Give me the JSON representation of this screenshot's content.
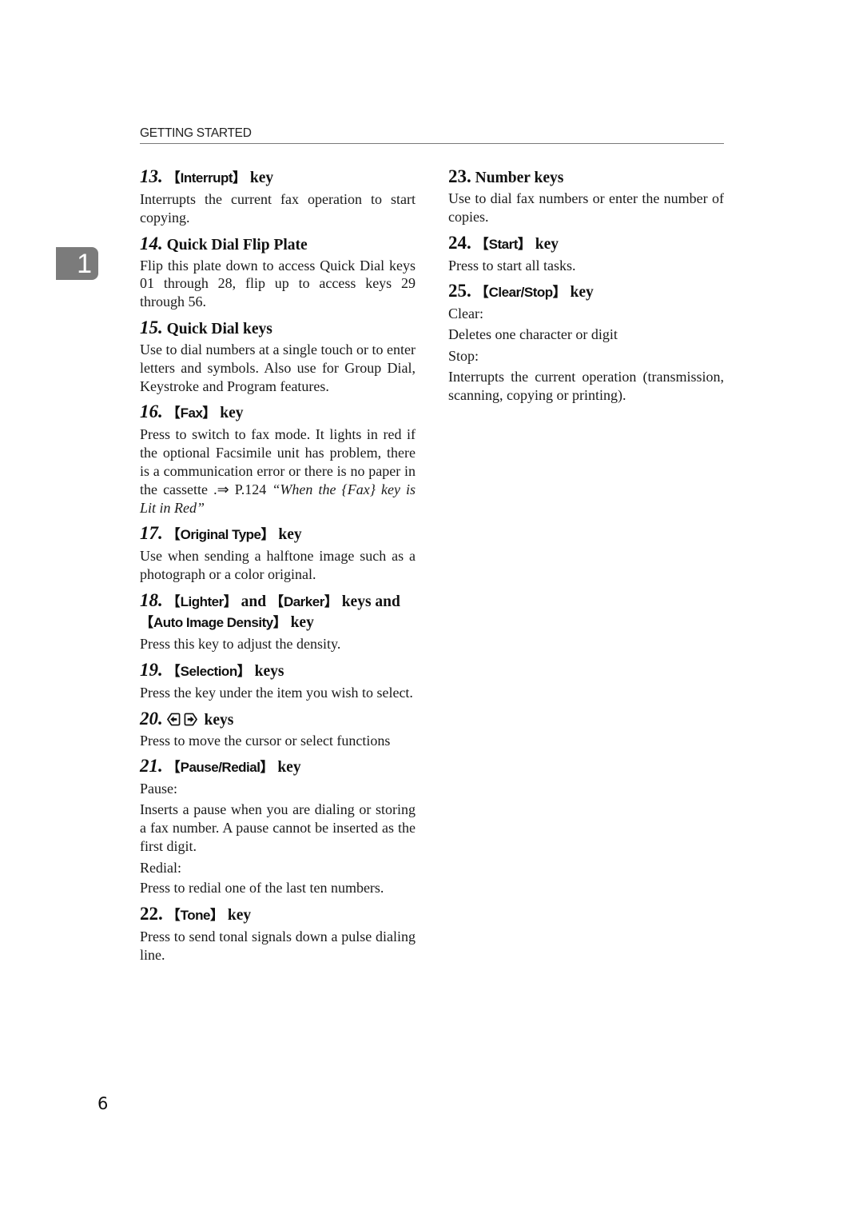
{
  "header": {
    "section_title": "GETTING STARTED"
  },
  "chapter_tab": {
    "number": "1"
  },
  "page_number": "6",
  "sections": {
    "s13": {
      "num": "13.",
      "key": "Interrupt",
      "suffix": "key",
      "body": "Interrupts the current fax operation to start copying."
    },
    "s14": {
      "num": "14.",
      "title": "Quick Dial Flip Plate",
      "body": "Flip this plate down to access Quick Dial keys 01 through 28, flip up to access keys 29 through 56."
    },
    "s15": {
      "num": "15.",
      "title": "Quick Dial keys",
      "body": "Use to dial numbers at a single touch or to enter letters and symbols. Also use for Group Dial, Keystroke and Program features."
    },
    "s16": {
      "num": "16.",
      "key": "Fax",
      "suffix": "key",
      "body": "Press to switch to fax mode. It lights in red if the optional Facsimile unit has problem, there is a communication error or there is no paper in the cassette .⇒",
      "ref_page": "P.124",
      "ref_title": "“When the {Fax} key is Lit in Red”"
    },
    "s17": {
      "num": "17.",
      "key": "Original Type",
      "suffix": "key",
      "body": "Use when sending a halftone image such as a photograph or a color original."
    },
    "s18": {
      "num": "18.",
      "key1": "Lighter",
      "and1": "and",
      "key2": "Darker",
      "mid": "keys and",
      "key3": "Auto Image Density",
      "suffix": "key",
      "body": "Press this key to adjust the density."
    },
    "s19": {
      "num": "19.",
      "key": "Selection",
      "suffix": "keys",
      "body": "Press the key under the item you wish to select."
    },
    "s20": {
      "num": "20.",
      "icons": [
        "left-arrow-key-icon",
        "right-arrow-key-icon"
      ],
      "suffix": "keys",
      "body": "Press to move the cursor or select functions"
    },
    "s21": {
      "num": "21.",
      "key": "Pause/Redial",
      "suffix": "key",
      "label1": "Pause:",
      "body1": "Inserts a pause when you are dialing or storing a fax number. A pause cannot be inserted as the first digit.",
      "label2": "Redial:",
      "body2": "Press to redial one of the last ten numbers."
    },
    "s22": {
      "num": "22.",
      "key": "Tone",
      "suffix": "key",
      "body": "Press to send tonal signals down a pulse dialing line."
    },
    "s23": {
      "num": "23.",
      "title": "Number keys",
      "body": "Use to dial fax numbers or enter the number of copies."
    },
    "s24": {
      "num": "24.",
      "key": "Start",
      "suffix": "key",
      "body": "Press to start all tasks."
    },
    "s25": {
      "num": "25.",
      "key": "Clear/Stop",
      "suffix": "key",
      "label1": "Clear:",
      "body1": "Deletes one character or digit",
      "label2": "Stop:",
      "body2": "Interrupts the current operation (transmission, scanning, copying or printing)."
    }
  },
  "brackets": {
    "open": "【",
    "close": "】"
  }
}
